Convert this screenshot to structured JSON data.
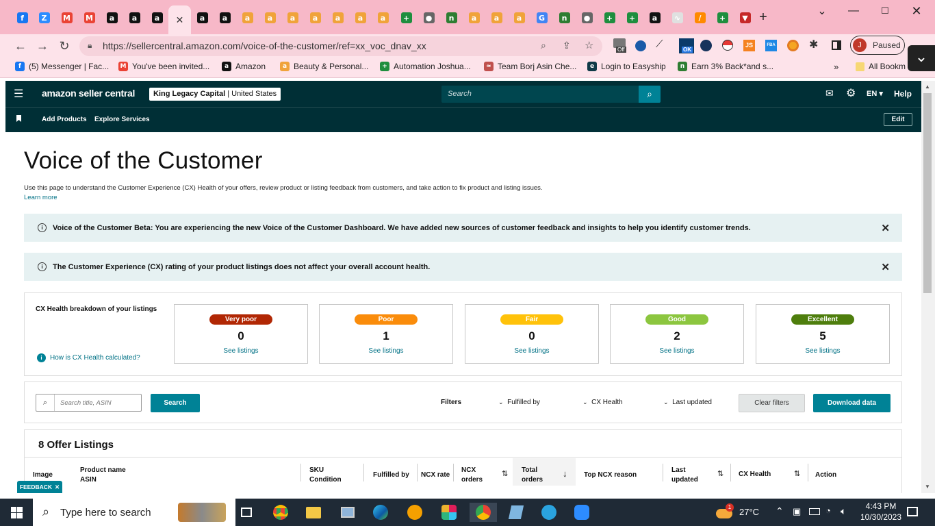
{
  "browser": {
    "tabs": [
      {
        "icon": "facebook-icon",
        "color": "#1877f2",
        "glyph": "f"
      },
      {
        "icon": "zoom-icon",
        "color": "#2d8cff",
        "glyph": "Z"
      },
      {
        "icon": "gmail-icon",
        "color": "#ea4335",
        "glyph": "M"
      },
      {
        "icon": "gmail-icon",
        "color": "#ea4335",
        "glyph": "M"
      },
      {
        "icon": "amazon-icon",
        "color": "#111111",
        "glyph": "a"
      },
      {
        "icon": "amazon-icon",
        "color": "#111111",
        "glyph": "a"
      },
      {
        "icon": "amazon-icon",
        "color": "#111111",
        "glyph": "a"
      },
      {
        "icon": "close-icon",
        "active": true
      },
      {
        "icon": "amazon-icon",
        "color": "#111111",
        "glyph": "a"
      },
      {
        "icon": "amazon-icon",
        "color": "#111111",
        "glyph": "a"
      },
      {
        "icon": "amazon-smile-icon",
        "color": "#f0a33a",
        "glyph": "a"
      },
      {
        "icon": "amazon-smile-icon",
        "color": "#f0a33a",
        "glyph": "a"
      },
      {
        "icon": "amazon-smile-icon",
        "color": "#f0a33a",
        "glyph": "a"
      },
      {
        "icon": "amazon-smile-icon",
        "color": "#f0a33a",
        "glyph": "a"
      },
      {
        "icon": "amazon-smile-icon",
        "color": "#f0a33a",
        "glyph": "a"
      },
      {
        "icon": "amazon-smile-icon",
        "color": "#f0a33a",
        "glyph": "a"
      },
      {
        "icon": "amazon-smile-icon",
        "color": "#f0a33a",
        "glyph": "a"
      },
      {
        "icon": "sheets-plus-icon",
        "color": "#1e8e3e",
        "glyph": "+"
      },
      {
        "icon": "globe-icon",
        "color": "#666666",
        "glyph": "●"
      },
      {
        "icon": "n-logo-icon",
        "color": "#2e7d32",
        "glyph": "n"
      },
      {
        "icon": "amazon-smile-icon",
        "color": "#f0a33a",
        "glyph": "a"
      },
      {
        "icon": "amazon-smile-icon",
        "color": "#f0a33a",
        "glyph": "a"
      },
      {
        "icon": "amazon-smile-icon",
        "color": "#f0a33a",
        "glyph": "a"
      },
      {
        "icon": "google-icon",
        "color": "#4285f4",
        "glyph": "G"
      },
      {
        "icon": "n-logo-icon",
        "color": "#2e7d32",
        "glyph": "n"
      },
      {
        "icon": "globe-icon",
        "color": "#666666",
        "glyph": "●"
      },
      {
        "icon": "sheets-plus-icon",
        "color": "#1e8e3e",
        "glyph": "+"
      },
      {
        "icon": "sheets-plus-icon",
        "color": "#1e8e3e",
        "glyph": "+"
      },
      {
        "icon": "amazon-icon",
        "color": "#111111",
        "glyph": "a"
      },
      {
        "icon": "signal-icon",
        "color": "#e0e0e0",
        "glyph": "∿"
      },
      {
        "icon": "pencil-app-icon",
        "color": "#ff8a00",
        "glyph": "/"
      },
      {
        "icon": "sheets-plus-icon",
        "color": "#1e8e3e",
        "glyph": "+"
      },
      {
        "icon": "triangle-down-icon",
        "color": "#c62828",
        "glyph": "▼"
      }
    ],
    "new_tab_glyph": "+",
    "url": "https://sellercentral.amazon.com/voice-of-the-customer/ref=xx_voc_dnav_xx",
    "profile_initial": "J",
    "profile_status": "Paused",
    "extension_badge": "Off",
    "extension_ok": "OK",
    "ext_js": "JS",
    "ext_fba": "FBA",
    "bookmarks": [
      {
        "icon": "facebook-icon",
        "color": "#1877f2",
        "glyph": "f",
        "label": "(5) Messenger | Fac..."
      },
      {
        "icon": "gmail-icon",
        "color": "#ea4335",
        "glyph": "M",
        "label": "You've been invited..."
      },
      {
        "icon": "amazon-icon",
        "color": "#111111",
        "glyph": "a",
        "label": "Amazon"
      },
      {
        "icon": "amazon-smile-icon",
        "color": "#f0a33a",
        "glyph": "a",
        "label": "Beauty & Personal..."
      },
      {
        "icon": "sheets-plus-icon",
        "color": "#1e8e3e",
        "glyph": "+",
        "label": "Automation Joshua..."
      },
      {
        "icon": "team-icon",
        "color": "#c0504d",
        "glyph": "≈",
        "label": "Team Borj Asin Che..."
      },
      {
        "icon": "easyship-icon",
        "color": "#0f3a47",
        "glyph": "e",
        "label": "Login to Easyship"
      },
      {
        "icon": "n-logo-icon",
        "color": "#2e7d32",
        "glyph": "n",
        "label": "Earn 3% Back*and s..."
      }
    ],
    "bookmarks_more": "»",
    "all_bookmarks": "All Bookm"
  },
  "header": {
    "logo_text": "amazon seller central",
    "store_name": "King Legacy Capital",
    "store_region": "United States",
    "search_placeholder": "Search",
    "language": "EN",
    "help": "Help",
    "nav_items": [
      "Add Products",
      "Explore Services"
    ],
    "edit": "Edit"
  },
  "page": {
    "title": "Voice of the Customer",
    "description": "Use this page to understand the Customer Experience (CX) Health of your offers, review product or listing feedback from customers, and take action to fix product and listing issues.",
    "learn_more": "Learn more",
    "banner1": "Voice of the Customer Beta: You are experiencing the new Voice of the Customer Dashboard. We have added new sources of customer feedback and insights to help you identify customer trends.",
    "banner2": "The Customer Experience (CX) rating of your product listings does not affect your overall account health.",
    "breakdown_title": "CX Health breakdown of your listings",
    "how_calculated": "How is CX Health calculated?",
    "cards": [
      {
        "label": "Very poor",
        "count": "0",
        "link": "See listings",
        "color": "#b12704"
      },
      {
        "label": "Poor",
        "count": "1",
        "link": "See listings",
        "color": "#fa8c0b"
      },
      {
        "label": "Fair",
        "count": "0",
        "link": "See listings",
        "color": "#ffc20a"
      },
      {
        "label": "Good",
        "count": "2",
        "link": "See listings",
        "color": "#8cc63f"
      },
      {
        "label": "Excellent",
        "count": "5",
        "link": "See listings",
        "color": "#4e7e0d"
      }
    ],
    "search_placeholder": "Search title, ASIN",
    "search_button": "Search",
    "filters_label": "Filters",
    "filters": [
      "Fulfilled by",
      "CX Health",
      "Last updated"
    ],
    "clear_filters": "Clear filters",
    "download": "Download data",
    "listings_title": "8 Offer Listings",
    "columns": {
      "image": "Image",
      "product_name": "Product name",
      "asin": "ASIN",
      "sku": "SKU",
      "condition": "Condition",
      "fulfilled_by": "Fulfilled by",
      "ncx_rate": "NCX rate",
      "ncx_orders_1": "NCX",
      "ncx_orders_2": "orders",
      "total_orders_1": "Total",
      "total_orders_2": "orders",
      "top_ncx": "Top NCX reason",
      "last_updated_1": "Last",
      "last_updated_2": "updated",
      "cx_health": "CX Health",
      "action": "Action"
    },
    "feedback": "FEEDBACK"
  },
  "taskbar": {
    "search_placeholder": "Type here to search",
    "temperature": "27°C",
    "weather_badge": "1",
    "time": "4:43 PM",
    "date": "10/30/2023"
  }
}
